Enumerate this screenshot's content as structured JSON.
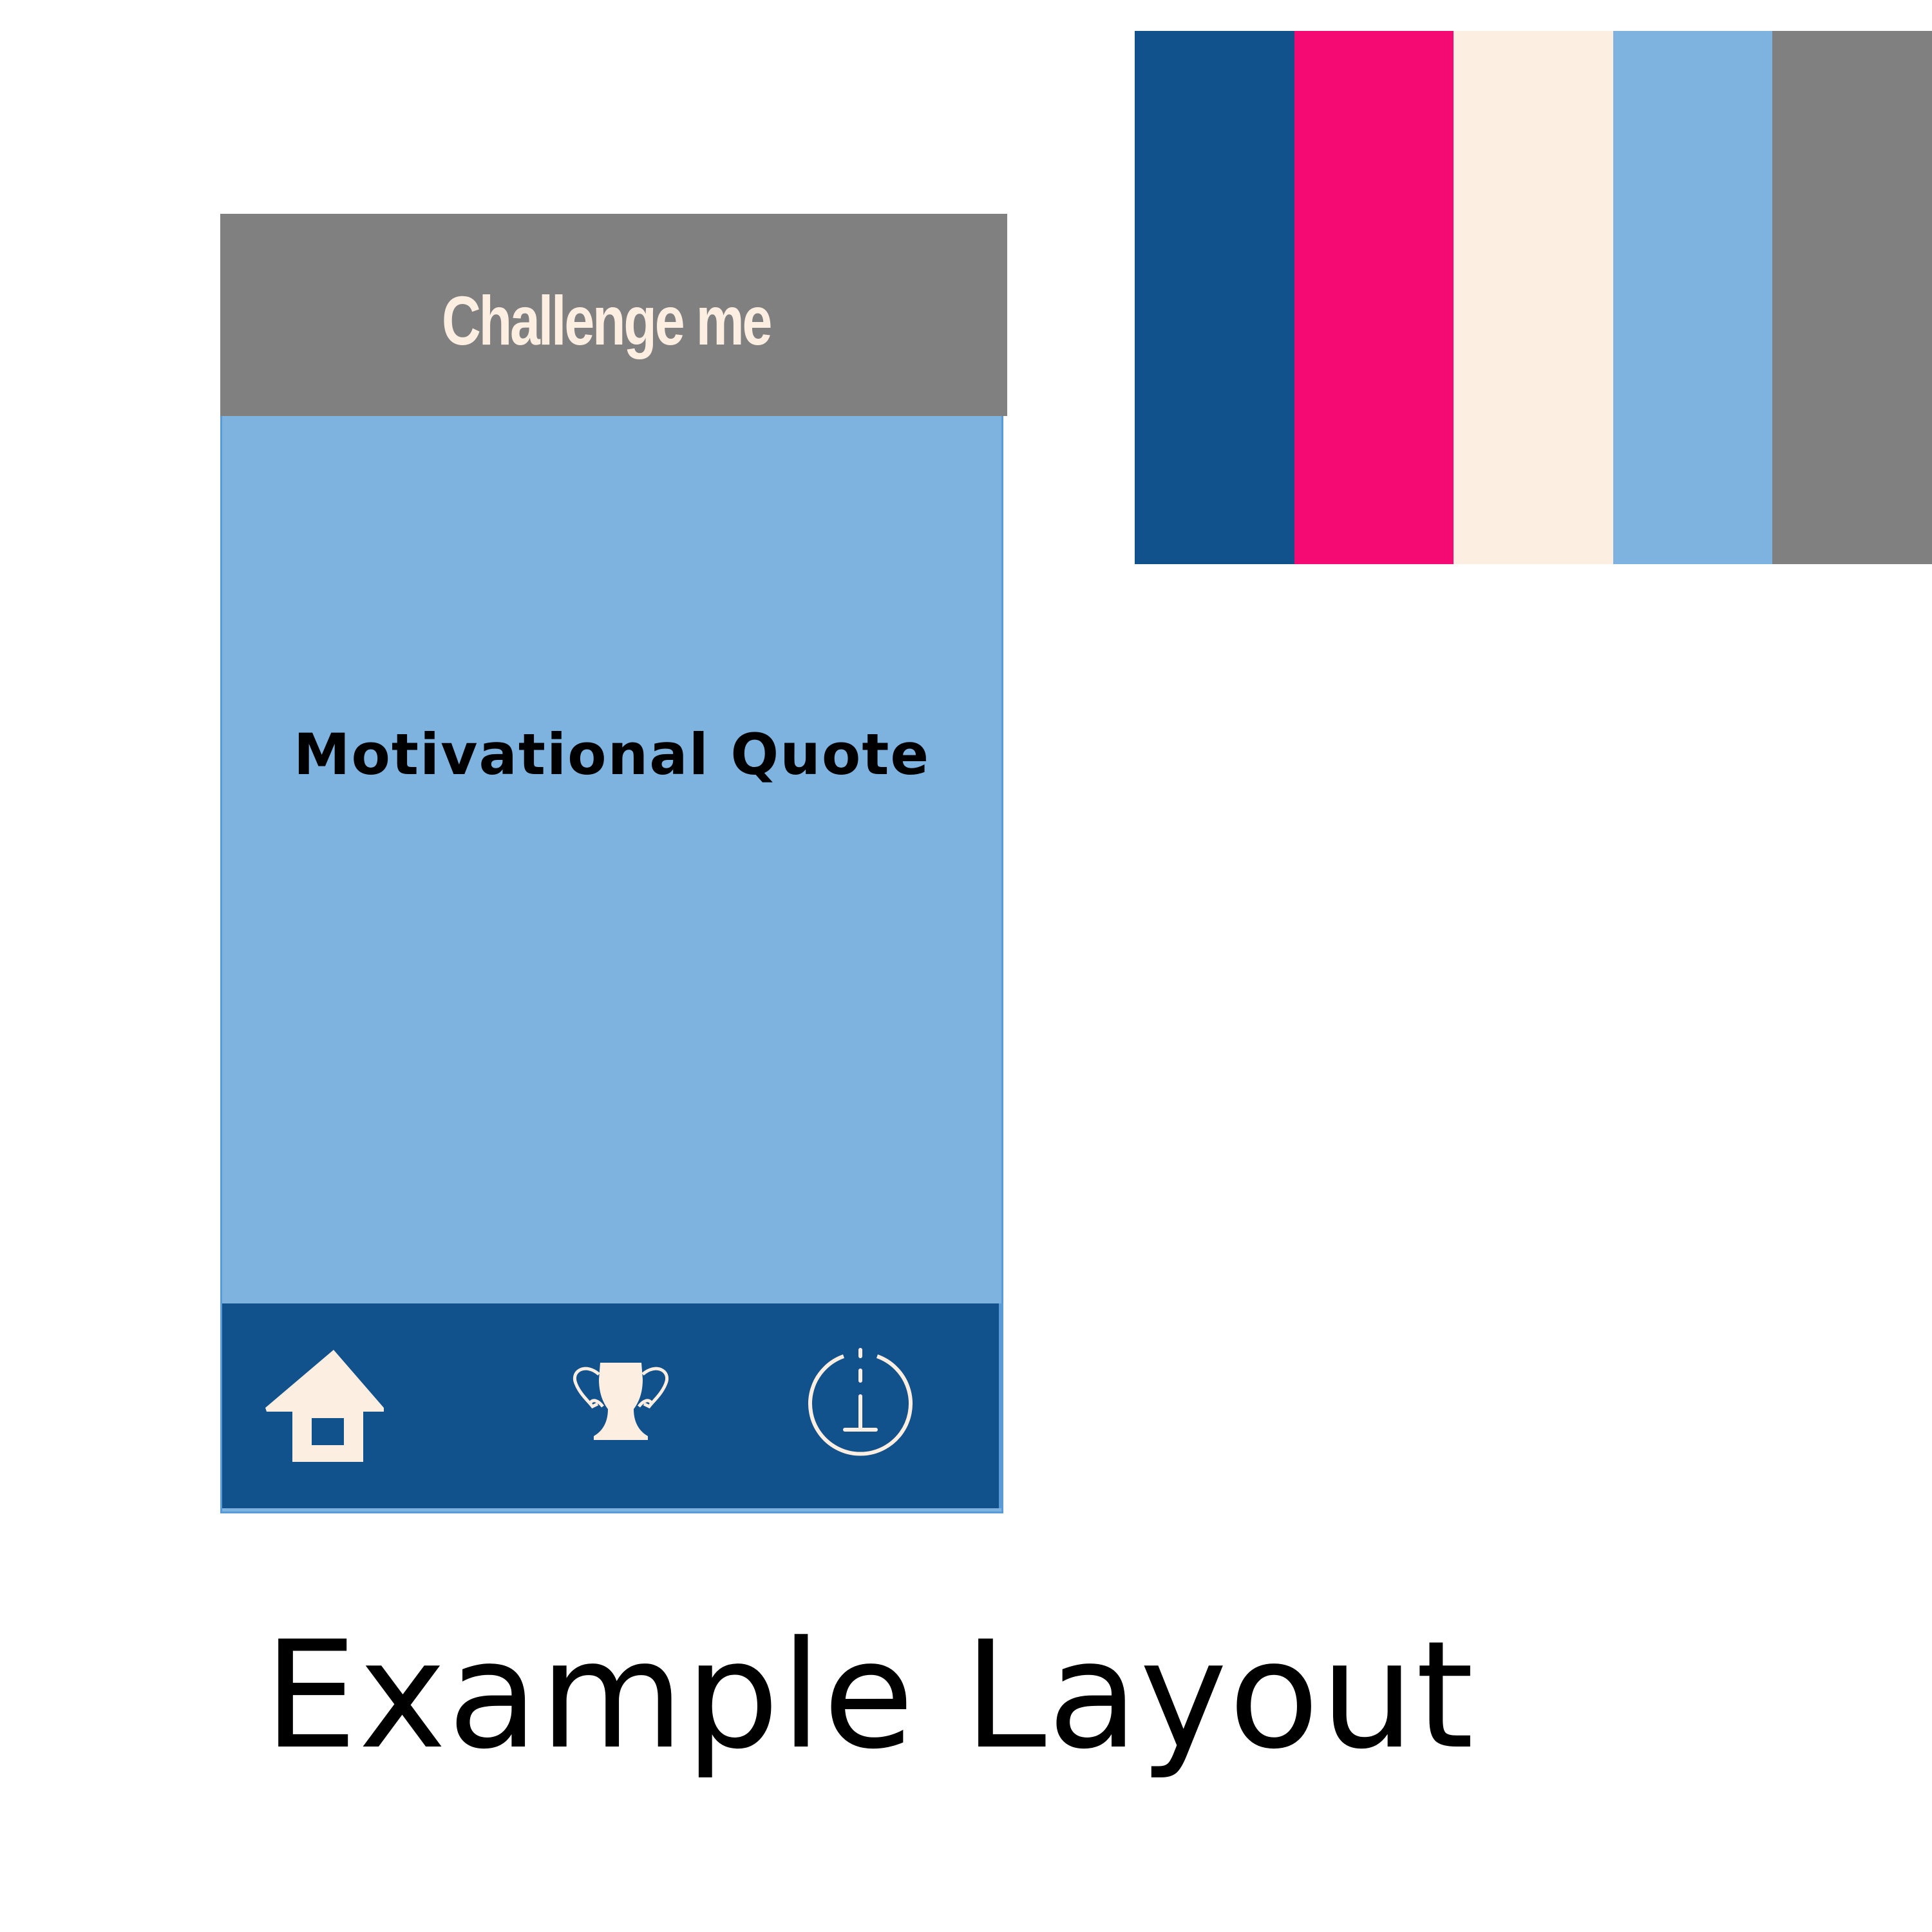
{
  "app": {
    "header_title": "Challenge me",
    "quote": "Motivational Quote"
  },
  "nav": {
    "items": [
      {
        "name": "home",
        "icon": "home-icon"
      },
      {
        "name": "trophy",
        "icon": "trophy-icon"
      },
      {
        "name": "power",
        "icon": "power-icon"
      }
    ]
  },
  "palette": {
    "colors": [
      "#11518c",
      "#f50a74",
      "#fdeee2",
      "#7eb2df",
      "#808080"
    ]
  },
  "caption": "Example Layout",
  "theme": {
    "header_bg": "#808080",
    "content_bg": "#7eb2df",
    "nav_bg": "#11518c",
    "accent_light": "#fdeee2"
  }
}
